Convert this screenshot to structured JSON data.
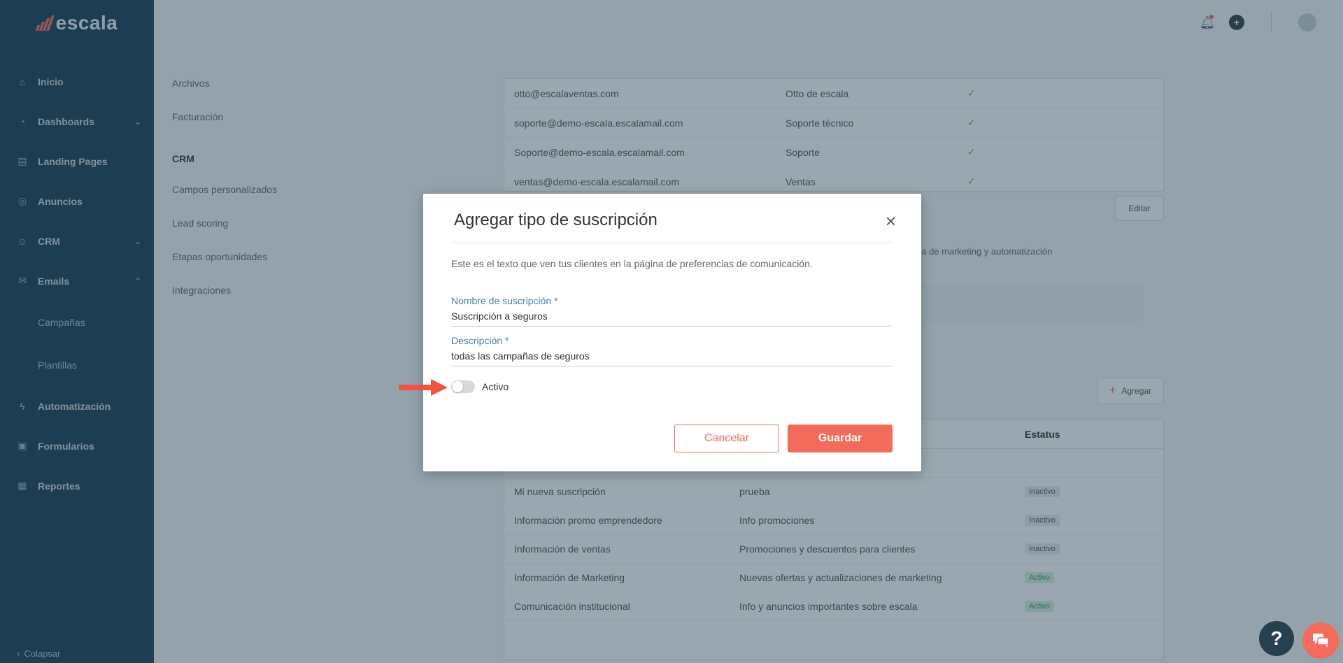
{
  "brand": {
    "name": "escala",
    "accent": "#f26b5b",
    "sidebar_bg": "#1d4055"
  },
  "sidebar": {
    "items": [
      {
        "label": "Inicio",
        "icon": "home-icon"
      },
      {
        "label": "Dashboards",
        "icon": "dashboard-icon"
      },
      {
        "label": "Landing Pages",
        "icon": "landing-icon"
      },
      {
        "label": "Anuncios",
        "icon": "ads-icon"
      },
      {
        "label": "CRM",
        "icon": "users-icon"
      },
      {
        "label": "Emails",
        "icon": "email-icon"
      },
      {
        "label": "Campañas"
      },
      {
        "label": "Plantillas"
      },
      {
        "label": "Automatización",
        "icon": "bolt-icon"
      },
      {
        "label": "Formularios",
        "icon": "form-icon"
      },
      {
        "label": "Reportes",
        "icon": "chart-icon"
      }
    ],
    "collapse_label": "Colapsar"
  },
  "settings_nav": {
    "items": [
      "Archivos",
      "Facturación"
    ],
    "crm_heading": "CRM",
    "crm_items": [
      "Campos personalizados",
      "Lead scoring",
      "Etapas oportunidades",
      "Integraciones"
    ]
  },
  "emails_table": {
    "rows": [
      {
        "email": "otto@escalaventas.com",
        "name": "Otto de escala"
      },
      {
        "email": "soporte@demo-escala.escalamail.com",
        "name": "Soporte técnico"
      },
      {
        "email": "Soporte@demo-escala.escalamail.com",
        "name": "Soporte"
      },
      {
        "email": "ventas@demo-escala.escalamail.com",
        "name": "Ventas"
      }
    ]
  },
  "edit_label": "Editar",
  "marketing_text": "da de marketing y automatización",
  "add_label": "Agregar",
  "subs_table": {
    "status_header": "Estatus",
    "rows": [
      {
        "name": "Mi nueva suscripción",
        "desc": "prueba",
        "status": "Inactivo"
      },
      {
        "name": "Información promo emprendedore",
        "desc": "Info promociones",
        "status": "Inactivo"
      },
      {
        "name": "Información de ventas",
        "desc": "Promociones y descuentos para clientes",
        "status": "Inactivo"
      },
      {
        "name": "Información de Marketing",
        "desc": "Nuevas ofertas y actualizaciones de marketing",
        "status": "Activo"
      },
      {
        "name": "Comunicación institucional",
        "desc": "Info y anuncios importantes sobre escala",
        "status": "Activo"
      }
    ]
  },
  "modal": {
    "title": "Agregar tipo de suscripción",
    "description": "Este es el texto que ven tus clientes en la página de preferencias de comunicación.",
    "name_label": "Nombre de suscripción *",
    "name_value": "Suscripción a seguros",
    "desc_label": "Descripción *",
    "desc_value": "todas las campañas de seguros",
    "active_label": "Activo",
    "active_state": false,
    "cancel_label": "Cancelar",
    "save_label": "Guardar"
  },
  "help_label": "?"
}
